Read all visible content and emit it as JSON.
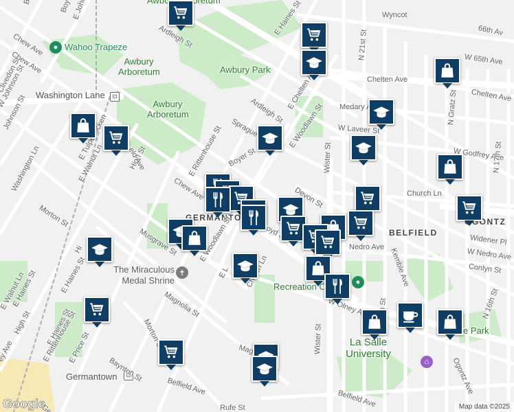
{
  "map": {
    "brand": "Google",
    "attribution": "Map data ©2025",
    "labels": {
      "awbury_top": "Awbury Arboretum",
      "wahoo": "Wahoo Trapeze",
      "awbury_arb_2": "Awbury Arboretum",
      "awbury_park": "Awbury Park",
      "awbury_arb_3": "Awbury Arboretum",
      "washington_lane": "Washington Lane",
      "miraculous": "The Miraculous Medal Shrine",
      "recreation": "Recreation C",
      "la_salle": "La Salle University",
      "germantown_hood": "GERMANTO",
      "germantown_station": "Germantown",
      "belfield_hood": "BELFIELD",
      "ogontz_hood": "OGONTZ",
      "park_partial": "e Park",
      "wyncote": "Wyncot",
      "ave_66": "66th Av",
      "chelten_ave_e": "Chelten Ave",
      "chelten_ave_w": "Chelten Ave",
      "chew_ave": "Chew Ave",
      "chew_ave_nw": "Chew Ave",
      "ardleigh_st_1": "Ardleigh St",
      "ardleigh_st_2": "Ardleigh St",
      "e_haines_st_ne": "E Haines St",
      "e_haines_st_sw": "E Haines St",
      "e_haines_st_w": "E Haines St",
      "e_chelten_ave": "E Chelten Ave",
      "sprague_st": "Sprague St",
      "boyer_st": "Boyer St",
      "boyer_st_top": "Boyer St",
      "e_rittenhouse_st": "E Rittenhouse St",
      "e_rittenhouse_st_sw": "E Rittenhouse St",
      "e_woodlawn_st": "E Woodlawn St",
      "e_woodlawn_st_2": "E Woodlawn St",
      "devon_st": "Devon St",
      "church_ln": "Church Ln",
      "church_ln_2": "Church Ln",
      "wister_st": "Wister St",
      "wister_st_2": "Wister St",
      "medary_ave": "Medary Ave",
      "w_laveer_st": "W Laveer St",
      "w_godfrey_ave": "W Godfrey Ave",
      "w_65th_ave": "W 65th Ave",
      "n_21st_st": "N 21st St",
      "n_gratz_st": "N Gratz St",
      "n_17th_st": "N 17th St",
      "n_20th_st": "N 20th St",
      "n_16th_st": "N 16th St",
      "widener_pl": "Widener Pl",
      "nedro_ave": "Nedro Ave",
      "w_nedro_ave": "W Nedro Ave",
      "conlyn_st": "Conlyn St",
      "kemble_ave": "Kemble Ave",
      "w_olney_ave": "W Olney Ave",
      "ogontz_ave": "Ogontz Ave",
      "high_st": "High St",
      "high_st_2": "High St",
      "morton_st": "Morton St",
      "morton_st_2": "Morton St",
      "musgrave_st": "Musgrave St",
      "magnolia_st": "Magnolia St",
      "baynton_st": "Baynton St",
      "belfield_ave": "Belfield Ave",
      "belfield_ave_2": "Belfield Ave",
      "rufe_st": "Rufe St",
      "e_walnut_ln": "E Walnut Ln",
      "e_walnut_ln_2": "E Walnut Ln",
      "e_tulpehocken": "E Tulpehocken",
      "washington_ln": "Washington Ln",
      "johnson_st": "Johnson St",
      "johnson_st_2": "W Johnson St",
      "clivedon_st": "Clivedon St",
      "e_price_st": "E Price St",
      "e_la_st": "E L",
      "boyd_st": "oyd St",
      "ave_field": "eld Ave",
      "chew_ave_left": "Chew Ave",
      "boyer_st_tl": "Boyer St",
      "e_johnson_st": "E Johnson St",
      "e_haines_left": "E Haines St",
      "hey_ave": "ey Ave",
      "mag_partial": "Mag",
      "hi_partial": "Hi",
      "germ_partial": "German",
      "w_olney_partial": "W Olney Av"
    }
  }
}
